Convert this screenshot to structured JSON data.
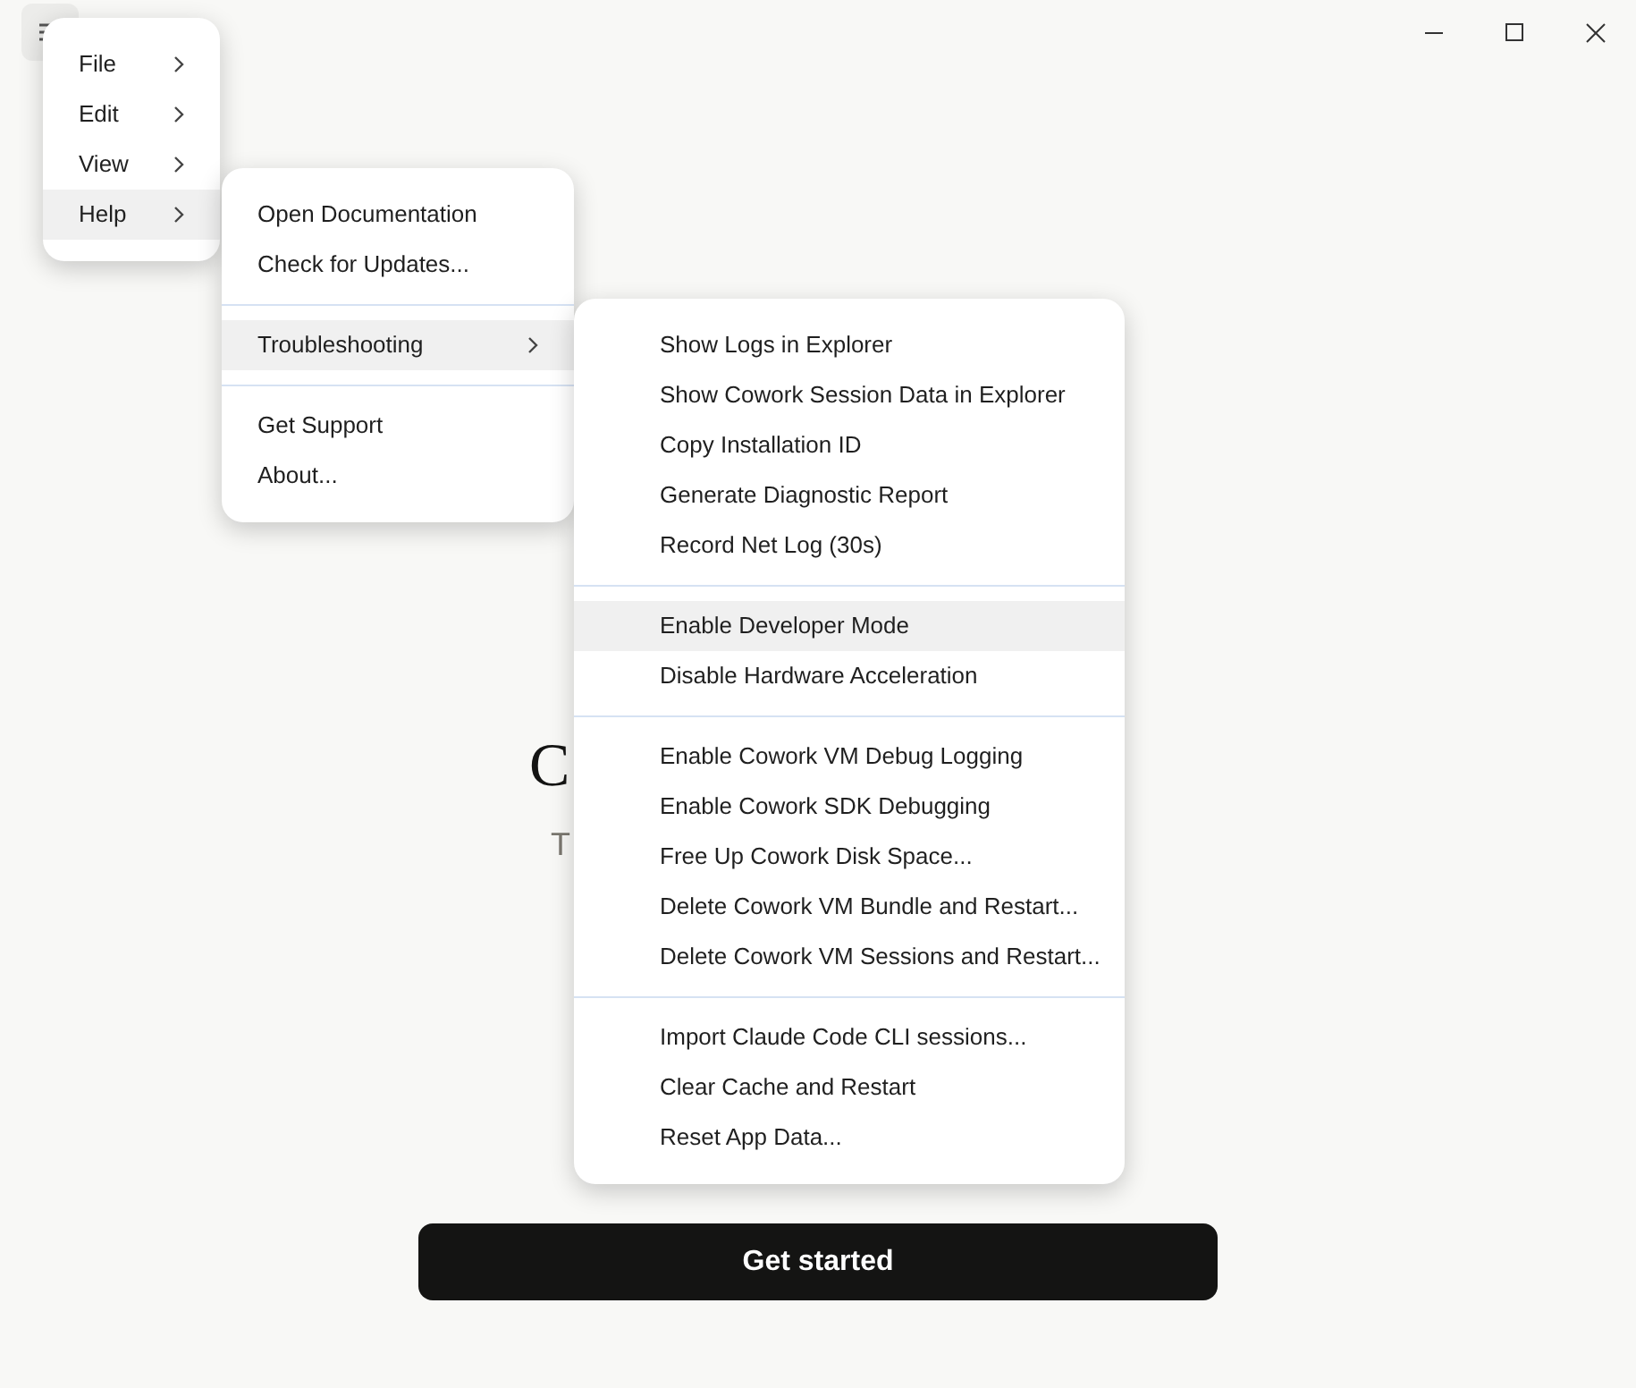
{
  "main": {
    "heading": "C",
    "subtitle": "T",
    "button": "Get started"
  },
  "app_menu": [
    {
      "label": "File",
      "selected": false
    },
    {
      "label": "Edit",
      "selected": false
    },
    {
      "label": "View",
      "selected": false
    },
    {
      "label": "Help",
      "selected": true
    }
  ],
  "help_menu": [
    [
      {
        "label": "Open Documentation",
        "kind": "item",
        "selected": false
      },
      {
        "label": "Check for Updates...",
        "kind": "item",
        "selected": false
      }
    ],
    [
      {
        "label": "Troubleshooting",
        "kind": "submenu",
        "selected": true
      }
    ],
    [
      {
        "label": "Get Support",
        "kind": "item",
        "selected": false
      },
      {
        "label": "About...",
        "kind": "item",
        "selected": false
      }
    ]
  ],
  "troubleshooting_menu": [
    [
      {
        "label": "Show Logs in Explorer",
        "selected": false
      },
      {
        "label": "Show Cowork Session Data in Explorer",
        "selected": false
      },
      {
        "label": "Copy Installation ID",
        "selected": false
      },
      {
        "label": "Generate Diagnostic Report",
        "selected": false
      },
      {
        "label": "Record Net Log (30s)",
        "selected": false
      }
    ],
    [
      {
        "label": "Enable Developer Mode",
        "selected": true
      },
      {
        "label": "Disable Hardware Acceleration",
        "selected": false
      }
    ],
    [
      {
        "label": "Enable Cowork VM Debug Logging",
        "selected": false
      },
      {
        "label": "Enable Cowork SDK Debugging",
        "selected": false
      },
      {
        "label": "Free Up Cowork Disk Space...",
        "selected": false
      },
      {
        "label": "Delete Cowork VM Bundle and Restart...",
        "selected": false
      },
      {
        "label": "Delete Cowork VM Sessions and Restart...",
        "selected": false
      }
    ],
    [
      {
        "label": "Import Claude Code CLI sessions...",
        "selected": false
      },
      {
        "label": "Clear Cache and Restart",
        "selected": false
      },
      {
        "label": "Reset App Data...",
        "selected": false
      }
    ]
  ]
}
